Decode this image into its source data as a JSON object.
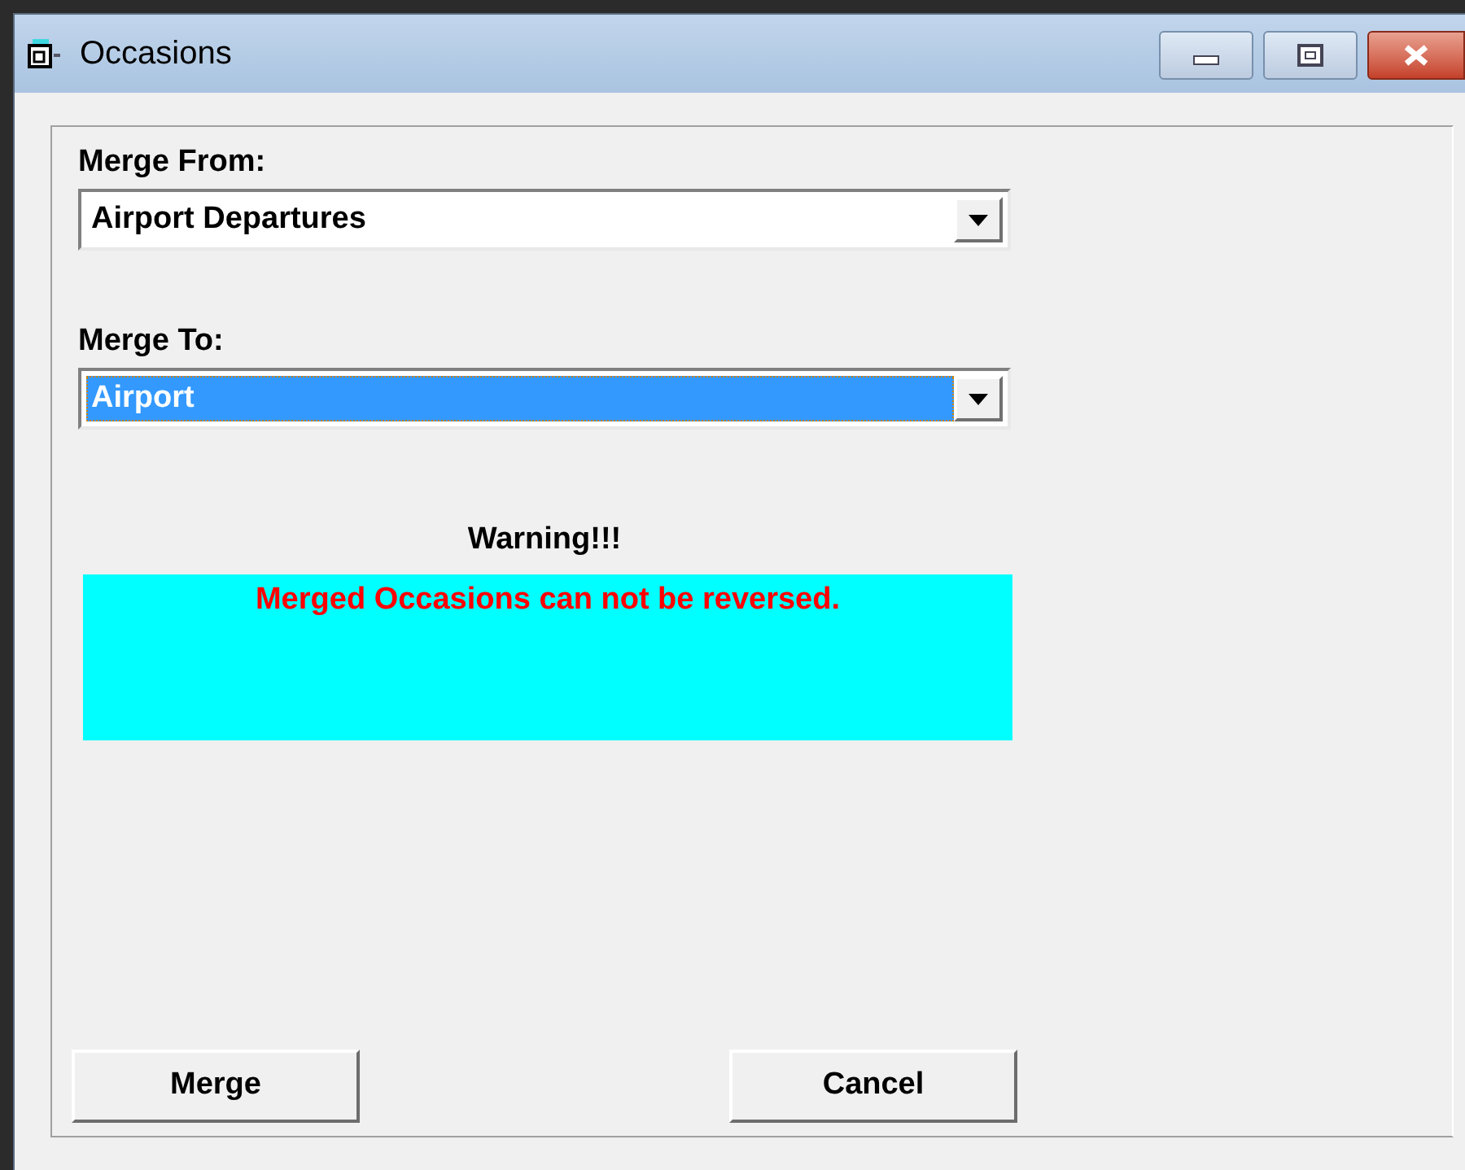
{
  "window": {
    "title": "Occasions"
  },
  "fields": [
    {
      "label": "Merge From:",
      "value": "Airport Departures",
      "selected": false
    },
    {
      "label": "Merge To:",
      "value": "Airport",
      "selected": true
    }
  ],
  "warning": {
    "title": "Warning!!!",
    "message": "Merged Occasions can not be reversed."
  },
  "buttons": [
    "Merge",
    "Cancel"
  ]
}
